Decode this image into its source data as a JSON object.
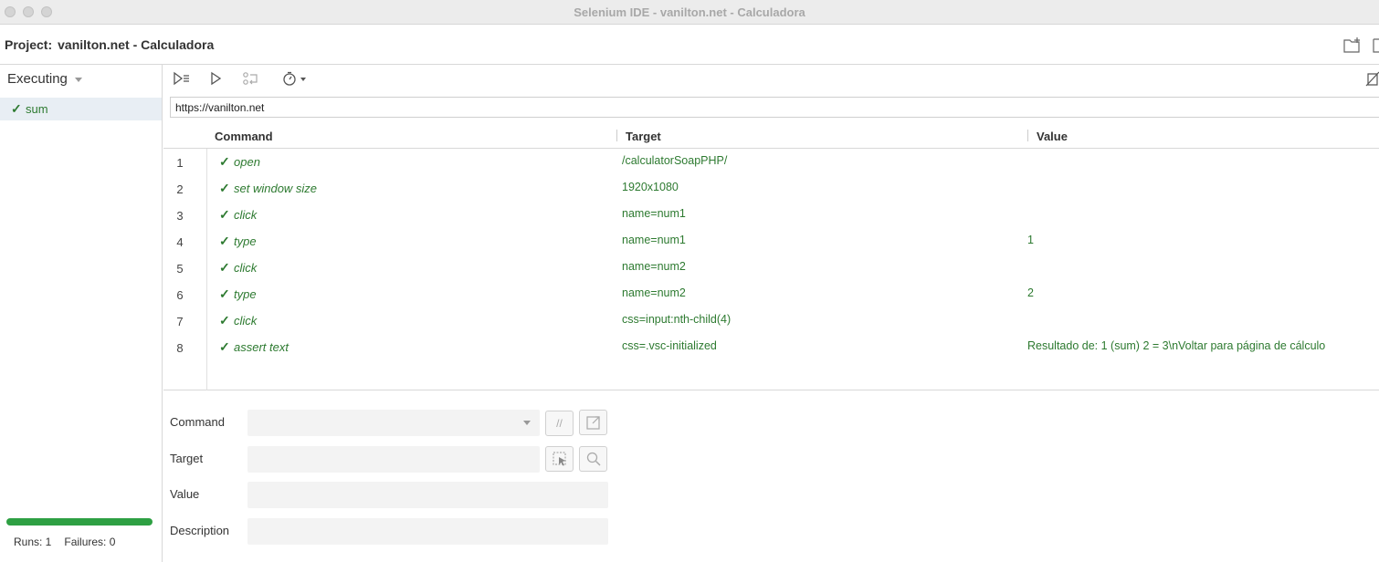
{
  "window": {
    "title": "Selenium IDE - vanilton.net - Calculadora"
  },
  "project": {
    "label": "Project:",
    "name": "vanilton.net - Calculadora"
  },
  "sidebar": {
    "header": "Executing",
    "tests": [
      {
        "name": "sum",
        "status": "passed"
      }
    ],
    "progress": 1.0,
    "runs_label": "Runs: 1",
    "failures_label": "Failures: 0"
  },
  "toolbar": {
    "icons": [
      "run-all-icon",
      "run-current-icon",
      "step-over-icon",
      "speed-icon"
    ]
  },
  "base_url": "https://vanilton.net",
  "table": {
    "headers": {
      "command": "Command",
      "target": "Target",
      "value": "Value"
    },
    "rows": [
      {
        "num": "1",
        "command": "open",
        "target": "/calculatorSoapPHP/",
        "value": ""
      },
      {
        "num": "2",
        "command": "set window size",
        "target": "1920x1080",
        "value": ""
      },
      {
        "num": "3",
        "command": "click",
        "target": "name=num1",
        "value": ""
      },
      {
        "num": "4",
        "command": "type",
        "target": "name=num1",
        "value": "1"
      },
      {
        "num": "5",
        "command": "click",
        "target": "name=num2",
        "value": ""
      },
      {
        "num": "6",
        "command": "type",
        "target": "name=num2",
        "value": "2"
      },
      {
        "num": "7",
        "command": "click",
        "target": "css=input:nth-child(4)",
        "value": ""
      },
      {
        "num": "8",
        "command": "assert text",
        "target": "css=.vsc-initialized",
        "value": "Resultado de: 1 (sum) 2 = 3\\nVoltar para página de cálculo"
      }
    ],
    "check_glyph": "✓"
  },
  "editor": {
    "command_label": "Command",
    "target_label": "Target",
    "value_label": "Value",
    "description_label": "Description",
    "comment_glyph": "//"
  },
  "colors": {
    "success": "#2d7a30",
    "progress": "#2ea043"
  }
}
